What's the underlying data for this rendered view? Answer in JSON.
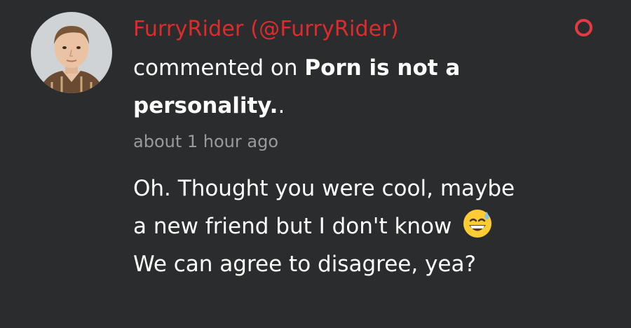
{
  "notification": {
    "author": "FurryRider (@FurryRider)",
    "action": "commented on ",
    "post_title": "Porn is not a personality.",
    "post_suffix": ".",
    "time_ago": "about 1 hour ago",
    "comment": {
      "part1": "Oh. Thought you were cool, maybe a new friend but I don't know ",
      "emoji": "grinning-face-with-sweat",
      "part2": " We can agree to disagree, yea?"
    },
    "unread_indicator_color": "#e63946",
    "author_color": "#e02b2b"
  }
}
